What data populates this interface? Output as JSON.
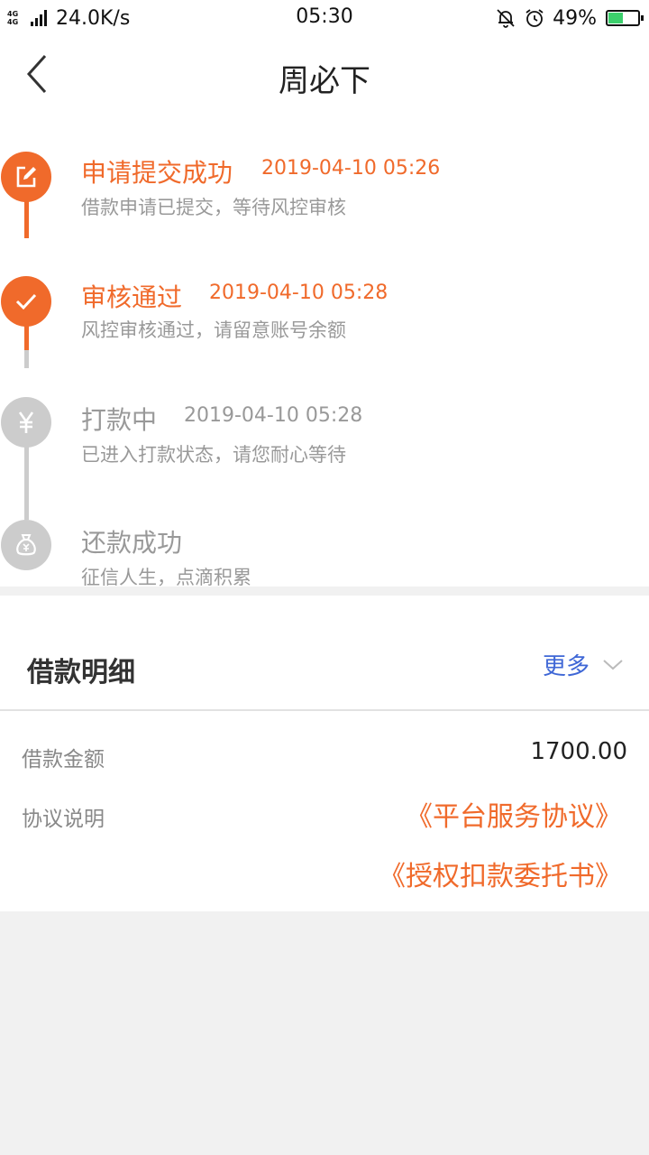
{
  "status_bar": {
    "network": "4G 4G",
    "speed": "24.0K/s",
    "time": "05:30",
    "battery_percent": "49%",
    "battery_level": 0.49,
    "icons": [
      "mute-bell-icon",
      "alarm-clock-icon",
      "battery-charging-icon"
    ]
  },
  "nav": {
    "back_icon": "chevron-left-icon",
    "title": "周必下"
  },
  "timeline": {
    "steps": [
      {
        "title": "申请提交成功",
        "time": "2019-04-10 05:26",
        "desc": "借款申请已提交，等待风控审核",
        "icon": "edit-icon",
        "state": "done"
      },
      {
        "title": "审核通过",
        "time": "2019-04-10 05:28",
        "desc": "风控审核通过，请留意账号余额",
        "icon": "check-icon",
        "state": "done"
      },
      {
        "title": "打款中",
        "time": "2019-04-10 05:28",
        "desc": "已进入打款状态，请您耐心等待",
        "icon": "yen-icon",
        "state": "pending"
      },
      {
        "title": "还款成功",
        "time": "",
        "desc": "征信人生，点滴积累",
        "icon": "money-bag-icon",
        "state": "pending"
      }
    ]
  },
  "detail": {
    "title": "借款明细",
    "more_label": "更多",
    "rows": {
      "amount_label": "借款金额",
      "amount_value": "1700.00",
      "agreement_label": "协议说明"
    },
    "agreements": [
      "《平台服务协议》",
      "《授权扣款委托书》"
    ]
  },
  "colors": {
    "accent": "#f06a2b",
    "inactive": "#cccccc",
    "link_blue": "#3f67d6"
  }
}
